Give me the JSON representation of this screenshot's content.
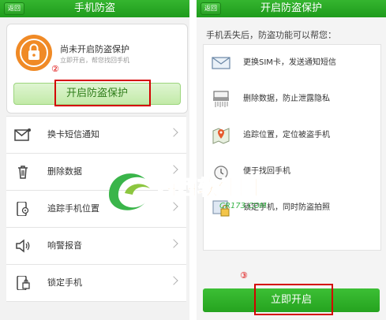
{
  "left_screen": {
    "back_label": "返回",
    "title": "手机防盗",
    "status_main": "尚未开启防盗保护",
    "status_sub": "立即开启，帮您找回手机",
    "step_marker": "②",
    "protect_button_label": "开启防盗保护",
    "menu_items": [
      {
        "label": "换卡短信通知",
        "icon": "sms-envelope-icon"
      },
      {
        "label": "删除数据",
        "icon": "trash-icon"
      },
      {
        "label": "追踪手机位置",
        "icon": "phone-location-icon"
      },
      {
        "label": "响警报音",
        "icon": "speaker-icon"
      },
      {
        "label": "锁定手机",
        "icon": "phone-lock-icon"
      }
    ]
  },
  "right_screen": {
    "back_label": "返回",
    "title": "开启防盗保护",
    "subtitle": "手机丢失后，防盗功能可以帮您：",
    "features": [
      {
        "label": "更换SIM卡，发送通知短信",
        "icon": "envelope-icon"
      },
      {
        "label": "删除数据，防止泄露隐私",
        "icon": "shredder-icon"
      },
      {
        "label": "追踪位置，定位被盗手机",
        "icon": "map-pin-icon"
      },
      {
        "label": "便于找回手机",
        "icon": "alarm-icon"
      },
      {
        "label": "锁定手机，同时防盗拍照",
        "icon": "lock-photo-icon"
      }
    ],
    "step_marker": "③",
    "start_button_label": "立即开启"
  },
  "watermark": {
    "main_text": "西西软件园",
    "sub_text": "CR173.COM"
  },
  "colors": {
    "header_green": "#28a724",
    "accent_orange": "#f08a26",
    "highlight_red": "#d40000"
  }
}
